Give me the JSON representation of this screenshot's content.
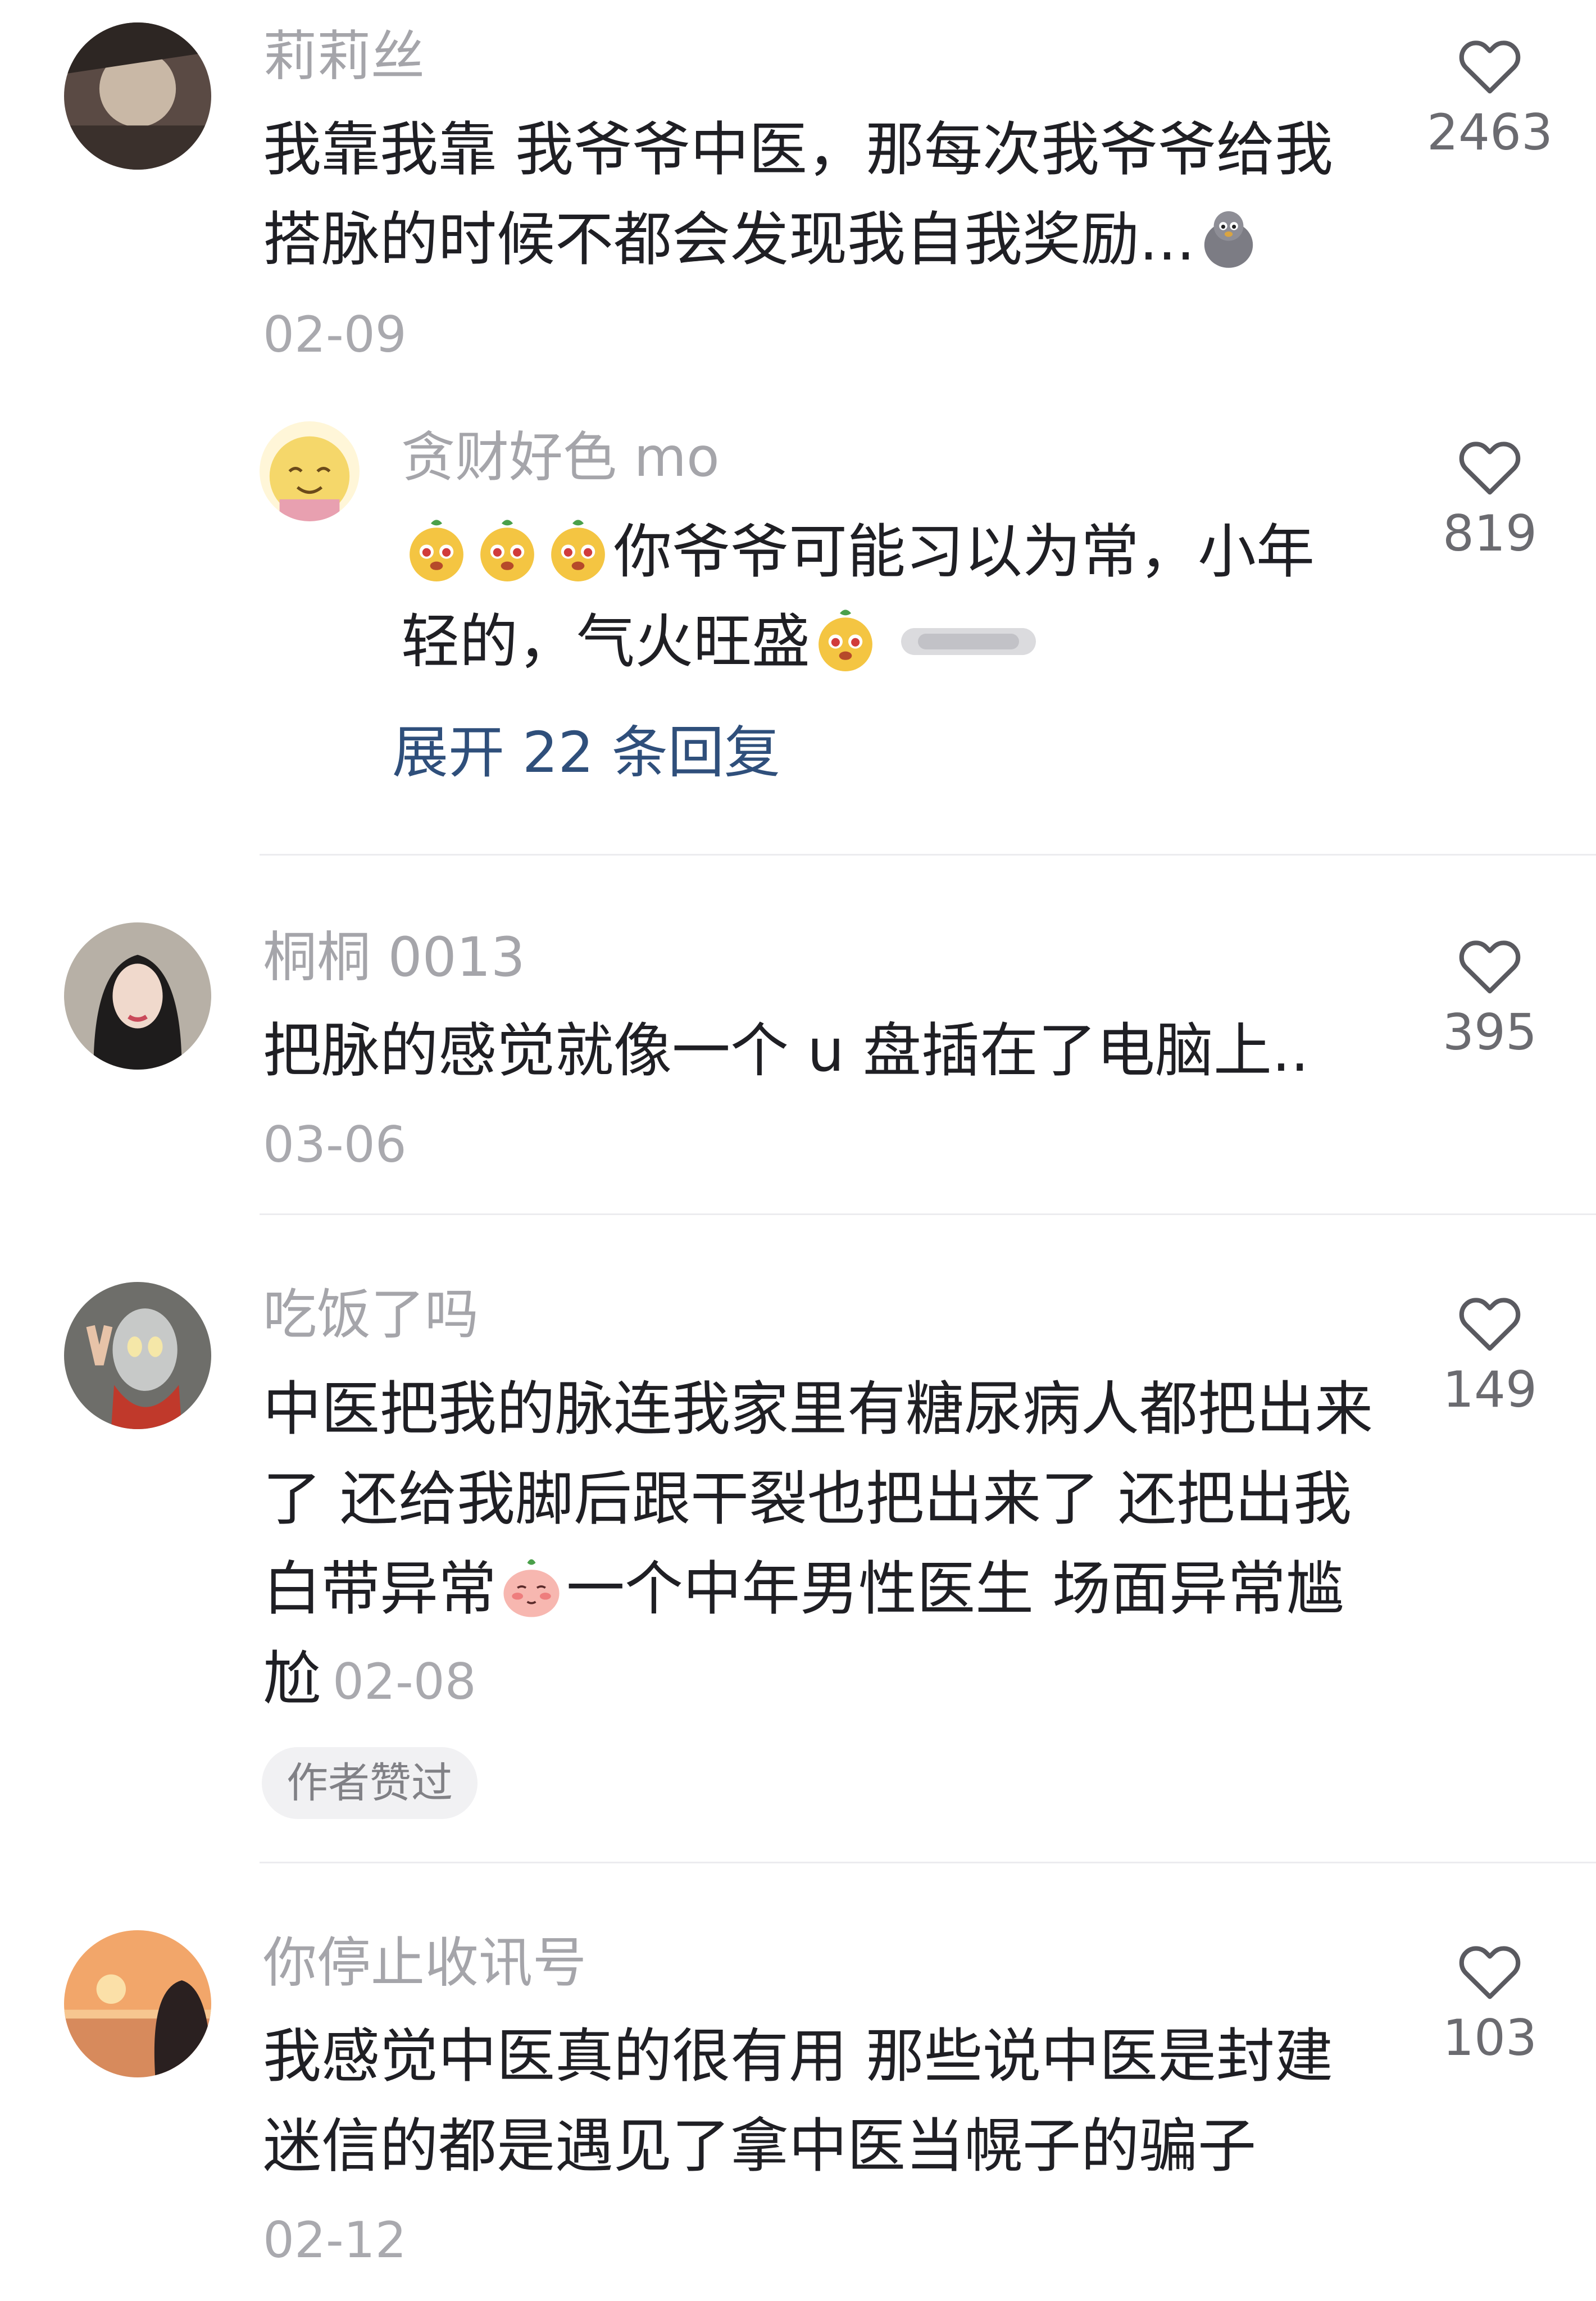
{
  "comments": [
    {
      "username": "莉莉丝",
      "lines": [
        "我靠我靠 我爷爷中医，那每次我爷爷给我",
        "搭脉的时候不都会发现我自我奖励..."
      ],
      "date": "02-09",
      "likes": "2463"
    },
    {
      "username": "贪财好色 mo",
      "line1": "你爷爷可能习以为常，小年",
      "line2": "轻的，气火旺盛",
      "likes": "819",
      "expand_label": "展开 22 条回复"
    },
    {
      "username": "桐桐 0013",
      "lines": [
        "把脉的感觉就像一个 u 盘插在了电脑上.."
      ],
      "date": "03-06",
      "likes": "395"
    },
    {
      "username": "吃饭了吗",
      "line1": "中医把我的脉连我家里有糖尿病人都把出来",
      "line2": "了 还给我脚后跟干裂也把出来了 还把出我",
      "line3a": "白带异常",
      "line3b": "一个中年男性医生 场面异常尴",
      "line4": "尬",
      "date": "02-08",
      "tag": "作者赞过",
      "likes": "149"
    },
    {
      "username": "你停止收讯号",
      "lines": [
        "我感觉中医真的很有用 那些说中医是封建",
        "迷信的都是遇见了拿中医当幌子的骗子"
      ],
      "date": "02-12",
      "likes": "103"
    }
  ],
  "icons": {
    "like": "heart-outline-icon",
    "emoji_1": "pigeon-emoji",
    "emoji_2": "puppy-emoji",
    "emoji_3": "blush-emoji"
  }
}
